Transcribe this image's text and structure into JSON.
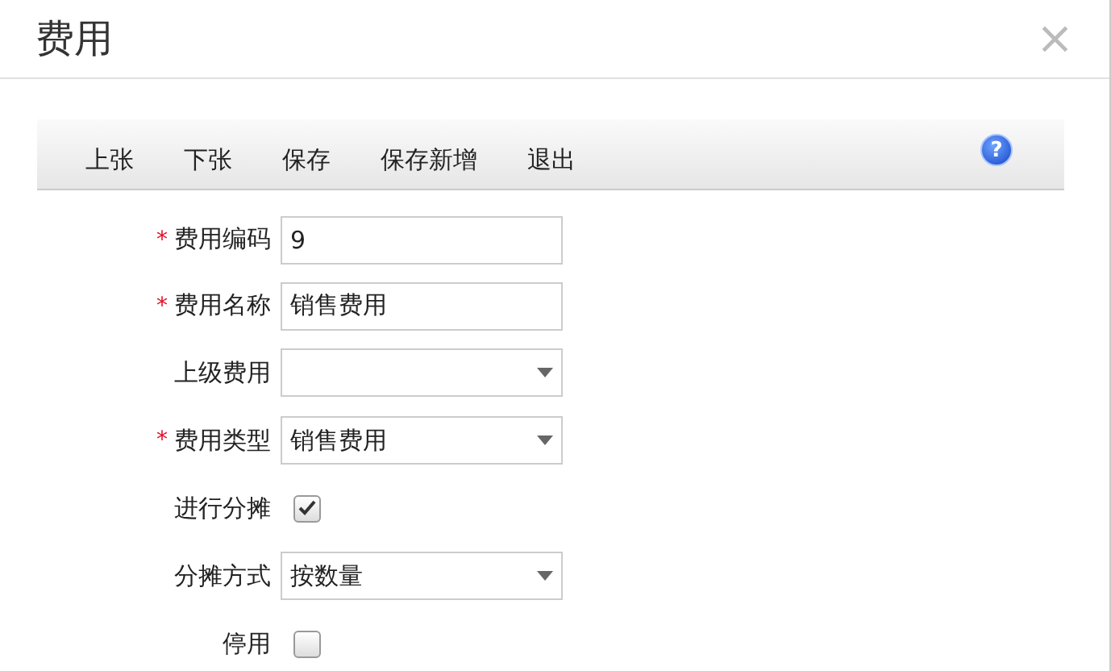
{
  "window": {
    "title": "费用",
    "close": "×"
  },
  "toolbar": {
    "buttons": [
      "上张",
      "下张",
      "保存",
      "保存新增",
      "退出"
    ],
    "help": "?"
  },
  "fields": [
    {
      "kind": "text",
      "label": "费用编码",
      "required_mark": "*",
      "value": "9"
    },
    {
      "kind": "text",
      "label": "费用名称",
      "required_mark": "*",
      "value": "销售费用"
    },
    {
      "kind": "select",
      "label": "上级费用"
    },
    {
      "kind": "select",
      "label": "费用类型",
      "required_mark": "*",
      "value": "销售费用"
    },
    {
      "kind": "checkbox",
      "label": "进行分摊",
      "checked": true
    },
    {
      "kind": "select",
      "label": "分摊方式",
      "value": "按数量"
    },
    {
      "kind": "checkbox",
      "label": "停用",
      "checked": false
    }
  ]
}
